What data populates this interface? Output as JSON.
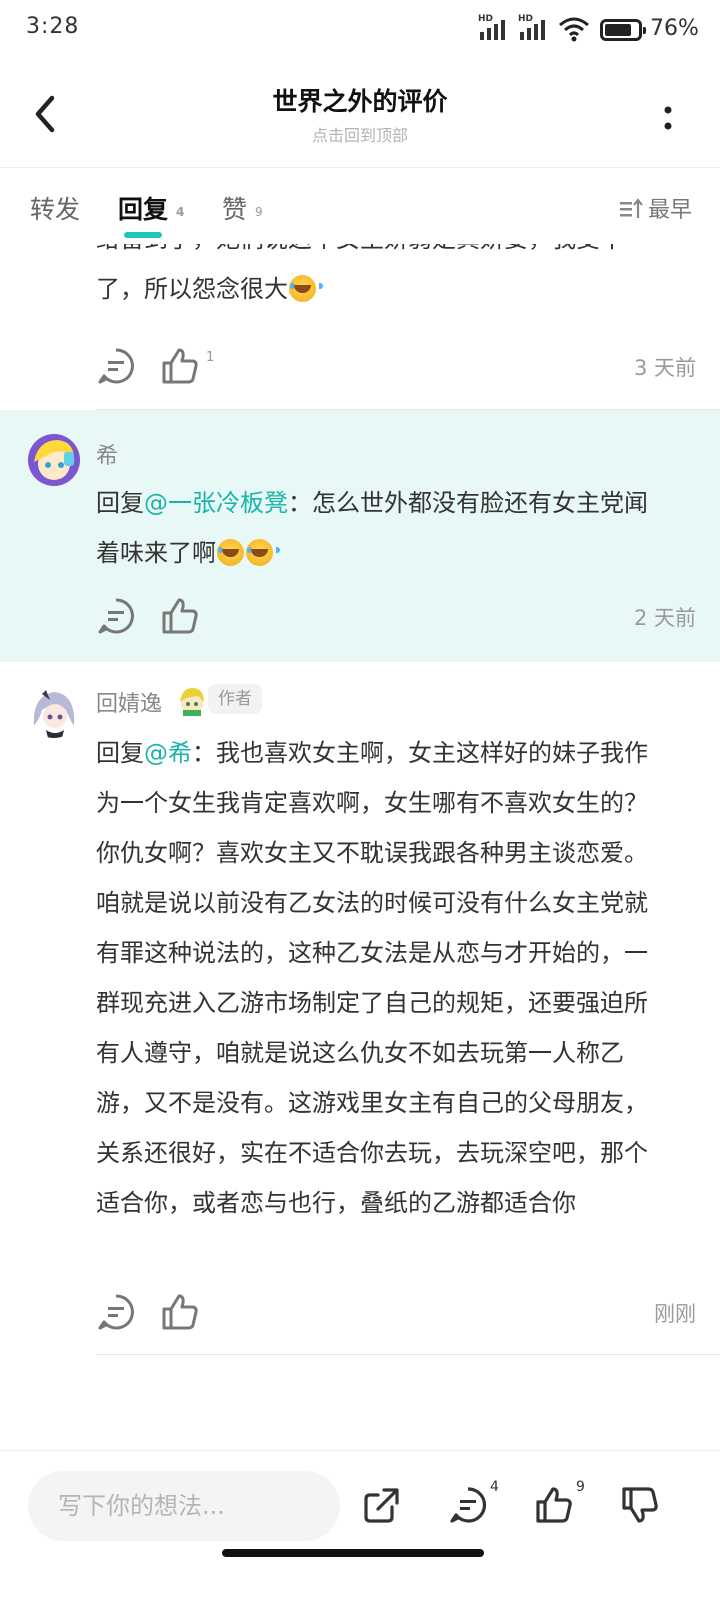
{
  "status_bar": {
    "time": "3:28",
    "battery_text": "76%",
    "battery_level": 0.76,
    "network_badge": "HD"
  },
  "header": {
    "title": "世界之外的评价",
    "subtitle": "点击回到顶部"
  },
  "tabs": [
    {
      "label": "转发",
      "count": ""
    },
    {
      "label": "回复",
      "count": "4"
    },
    {
      "label": "赞",
      "count": "9"
    }
  ],
  "sort_label": "最早",
  "comments": [
    {
      "text": "给留到了，她们说这个女主娇弱是真娇妾，我受不了，所以怨念很大",
      "likes": "1",
      "time": "3 天前"
    },
    {
      "username": "希",
      "reply_prefix": "回复",
      "mention": "@一张冷板凳",
      "sep": "：",
      "text": "怎么世外都没有脸还有女主党闻着味来了啊",
      "likes": "",
      "time": "2 天前"
    },
    {
      "username": "回婧逸",
      "badge": "作者",
      "reply_prefix": "回复",
      "mention": "@希",
      "sep": "：",
      "text": "我也喜欢女主啊，女主这样好的妹子我作为一个女生我肯定喜欢啊，女生哪有不喜欢女生的？你仇女啊？喜欢女主又不耽误我跟各种男主谈恋爱。咱就是说以前没有乙女法的时候可没有什么女主党就有罪这种说法的，这种乙女法是从恋与才开始的，一群现充进入乙游市场制定了自己的规矩，还要强迫所有人遵守，咱就是说这么仇女不如去玩第一人称乙游，又不是没有。这游戏里女主有自己的父母朋友，关系还很好，实在不适合你去玩，去玩深空吧，那个适合你，或者恋与也行，叠纸的乙游都适合你",
      "likes": "",
      "time": "刚刚"
    }
  ],
  "bottom_bar": {
    "input_placeholder": "写下你的想法...",
    "comment_count": "4",
    "like_count": "9"
  },
  "colors": {
    "accent": "#1ec6b8",
    "highlight_bg": "#e8f8f6"
  }
}
